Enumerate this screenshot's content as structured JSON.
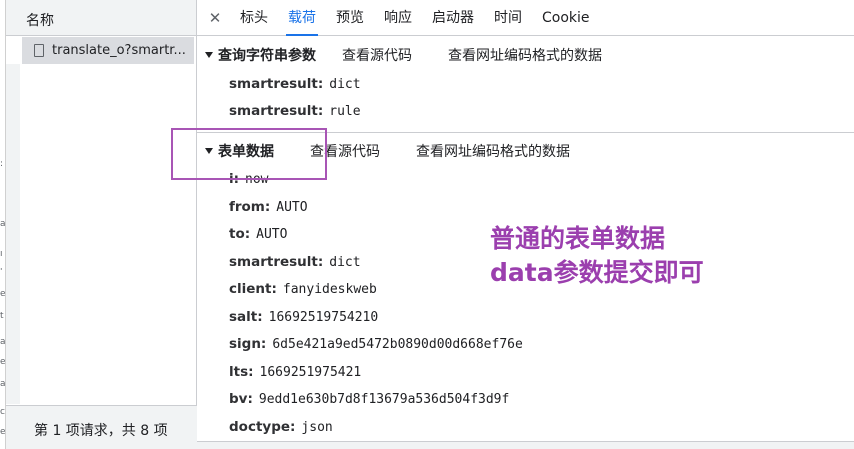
{
  "edge_strip": {
    "chars": [
      ":",
      "a",
      "ı",
      "'",
      "e",
      "t",
      "a",
      "e",
      "a",
      "c",
      "e"
    ]
  },
  "left_panel": {
    "header": "名称",
    "request_name": "translate_o?smartr...",
    "footer": "第 1 项请求，共 8 项"
  },
  "tabs": {
    "close": "✕",
    "items": [
      "标头",
      "载荷",
      "预览",
      "响应",
      "启动器",
      "时间",
      "Cookie"
    ],
    "active": "载荷"
  },
  "query_section": {
    "title": "查询字符串参数",
    "view_source": "查看源代码",
    "view_url_encoded": "查看网址编码格式的数据",
    "params": [
      {
        "key": "smartresult:",
        "value": "dict"
      },
      {
        "key": "smartresult:",
        "value": "rule"
      }
    ]
  },
  "form_section": {
    "title": "表单数据",
    "view_source": "查看源代码",
    "view_url_encoded": "查看网址编码格式的数据",
    "params": [
      {
        "key": "i:",
        "value": "now"
      },
      {
        "key": "from:",
        "value": "AUTO"
      },
      {
        "key": "to:",
        "value": "AUTO"
      },
      {
        "key": "smartresult:",
        "value": "dict"
      },
      {
        "key": "client:",
        "value": "fanyideskweb"
      },
      {
        "key": "salt:",
        "value": "16692519754210"
      },
      {
        "key": "sign:",
        "value": "6d5e421a9ed5472b0890d00d668ef76e"
      },
      {
        "key": "lts:",
        "value": "1669251975421"
      },
      {
        "key": "bv:",
        "value": "9edd1e630b7d8f13679a536d504f3d9f"
      },
      {
        "key": "doctype:",
        "value": "json"
      }
    ]
  },
  "annotation": {
    "line1": "普通的表单数据",
    "line2": "data参数提交即可",
    "color": "#9b3fae"
  },
  "colors": {
    "accent": "#1a73e8",
    "highlight_box": "#a855b5"
  }
}
